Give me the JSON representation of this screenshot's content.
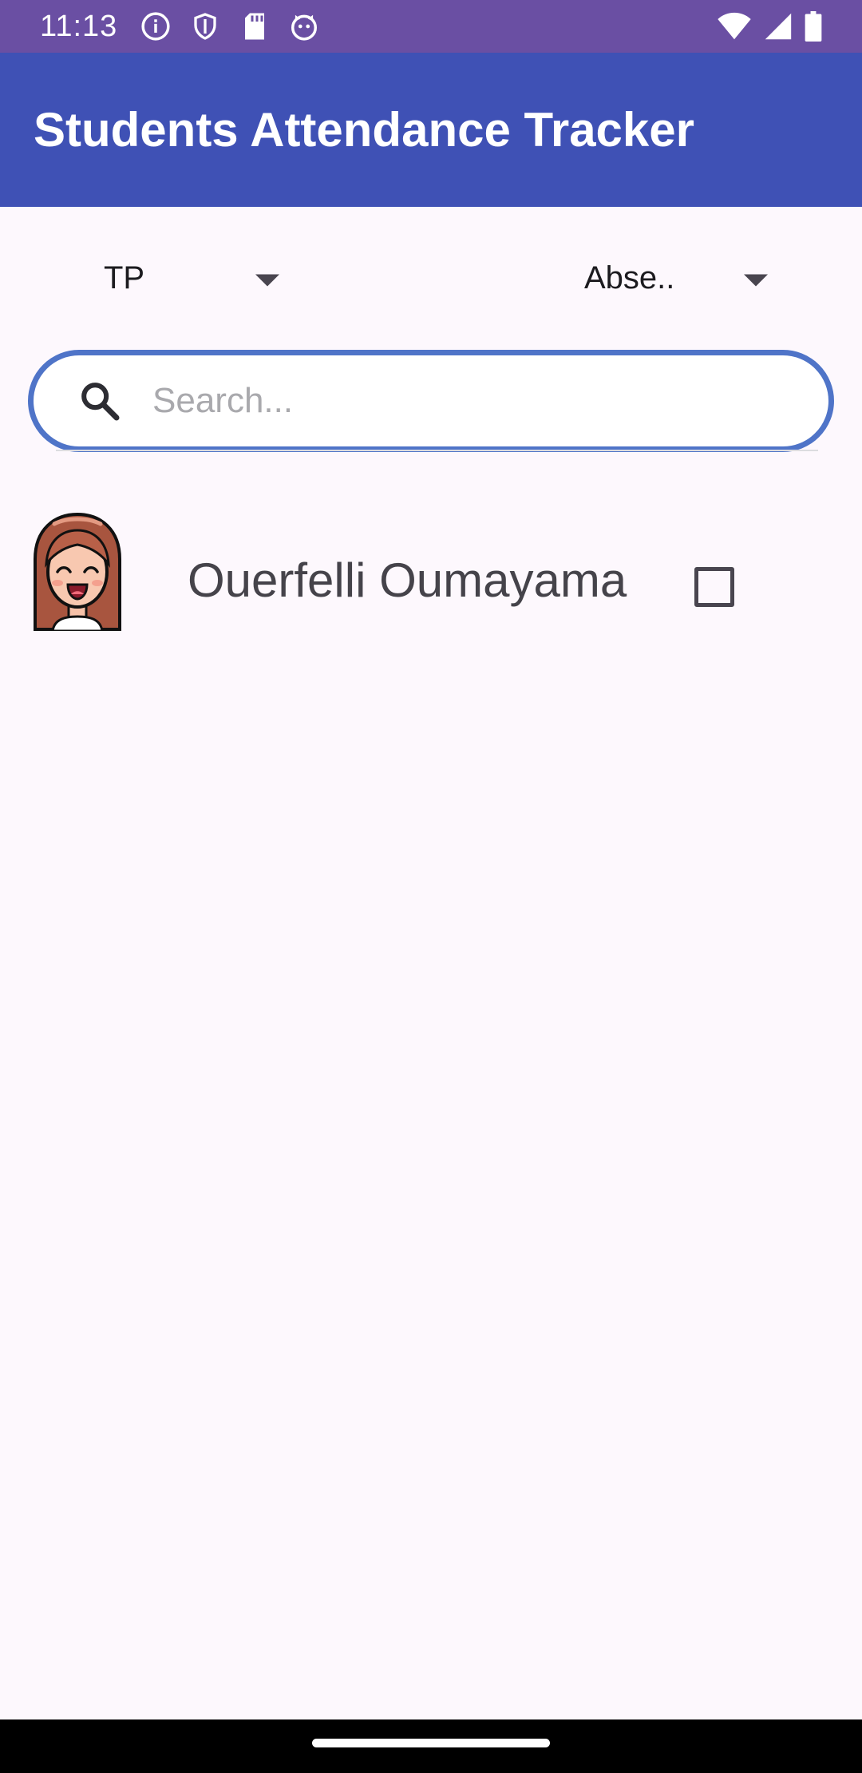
{
  "status_bar": {
    "time": "11:13",
    "icons_left": [
      "info-icon",
      "shield-icon",
      "sd-card-icon",
      "cat-face-icon"
    ],
    "icons_right": [
      "wifi-icon",
      "signal-icon",
      "battery-icon"
    ]
  },
  "app_bar": {
    "title": "Students Attendance Tracker"
  },
  "filters": {
    "left_spinner": {
      "selected": "TP"
    },
    "right_spinner": {
      "selected": "Abse.."
    }
  },
  "search": {
    "placeholder": "Search...",
    "value": ""
  },
  "students": [
    {
      "name": "Ouerfelli Oumayama",
      "checked": false,
      "avatar": "girl-avatar-icon"
    }
  ],
  "colors": {
    "status_bar": "#6a4fa3",
    "app_bar": "#3f51b5",
    "search_border": "#4f74c8",
    "background": "#fdf8fd"
  }
}
